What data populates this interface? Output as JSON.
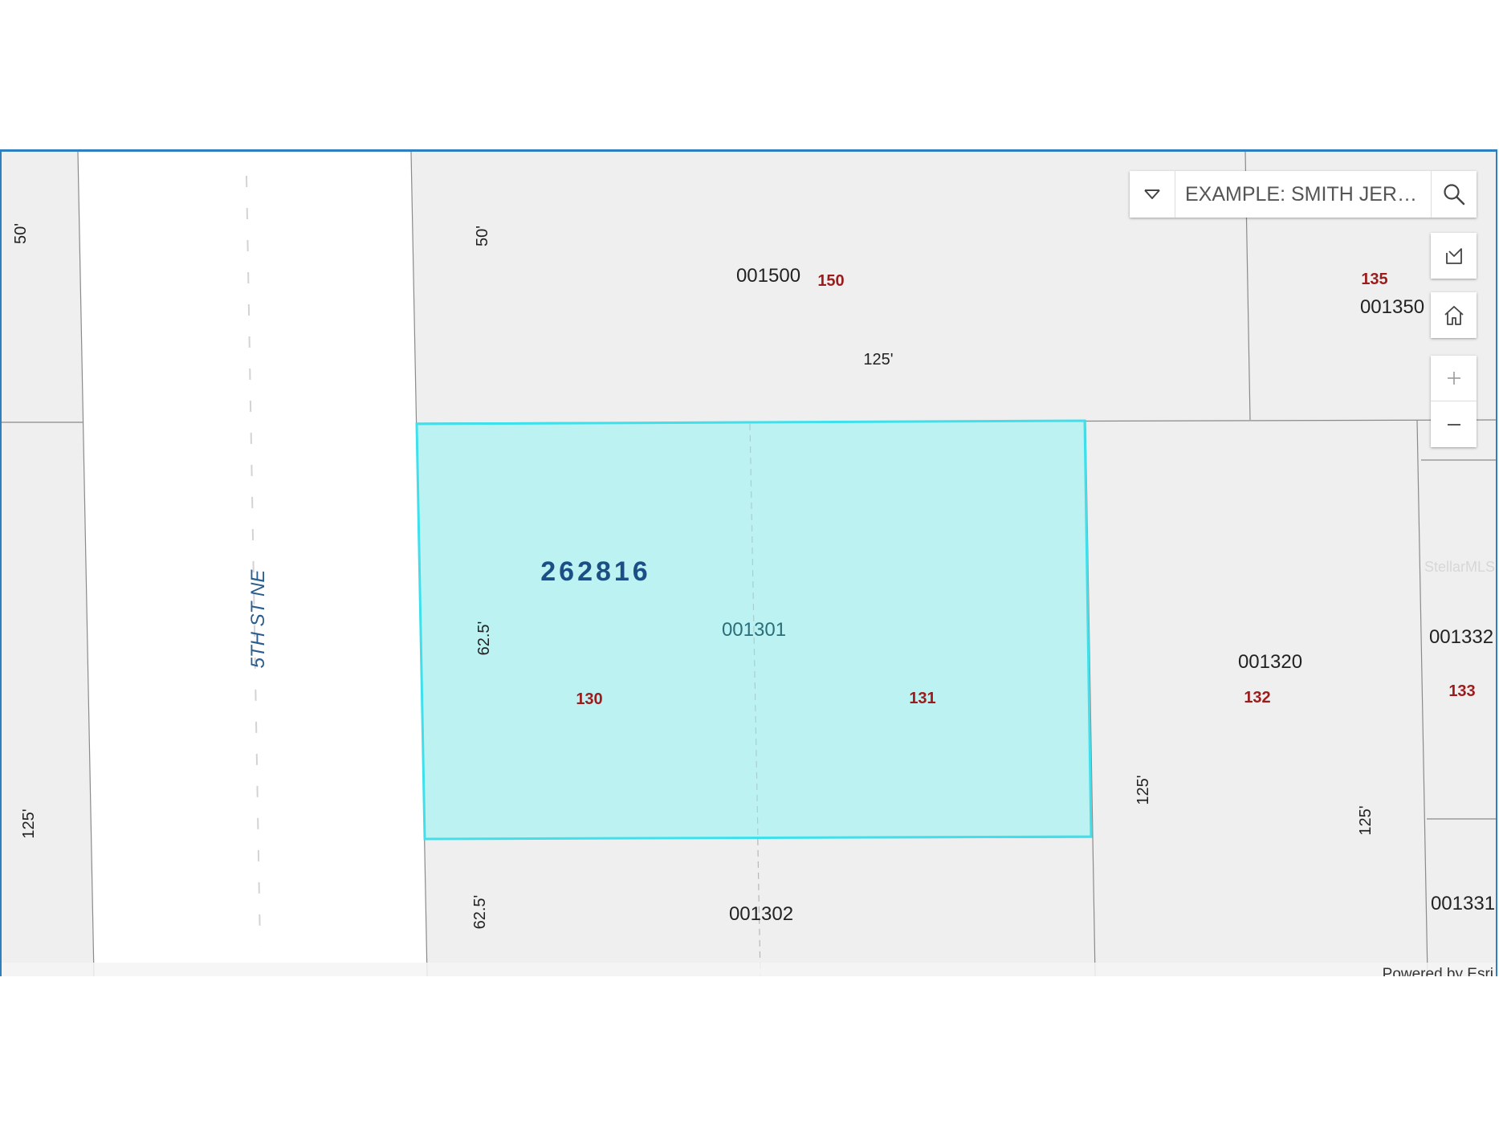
{
  "search": {
    "placeholder": "EXAMPLE: SMITH JERRY"
  },
  "icons": {
    "source_dropdown": "chevron-down-icon",
    "search": "search-icon",
    "basemap": "basemap-toggle-icon",
    "home": "home-icon",
    "zoom_in": "plus-icon",
    "zoom_out": "minus-icon"
  },
  "map": {
    "street_name": "5TH ST NE",
    "selected_parcel": {
      "account_number": "262816",
      "parcel_id": "001301",
      "lots": [
        "130",
        "131"
      ],
      "highlight_color": "#bdf2f2",
      "outline_color": "#3fe0ec"
    },
    "parcels": [
      {
        "id": "001500",
        "lot": "150"
      },
      {
        "id": "001350",
        "lot": "135"
      },
      {
        "id": "001320",
        "lot": "132"
      },
      {
        "id": "001332",
        "lot": "133"
      },
      {
        "id": "001331",
        "lot": ""
      },
      {
        "id": "001302",
        "lot": ""
      }
    ],
    "dimensions": {
      "left_strip_top": "50'",
      "left_strip_bottom": "125'",
      "parcel_001500_side": "50'",
      "parcel_001500_width": "125'",
      "selected_side": "62.5'",
      "parcel_001302_side": "62.5'",
      "parcel_001320_side_left": "125'",
      "parcel_001320_side_right": "125'"
    },
    "watermark": "StellarMLS",
    "attribution": "Powered by Esri"
  }
}
